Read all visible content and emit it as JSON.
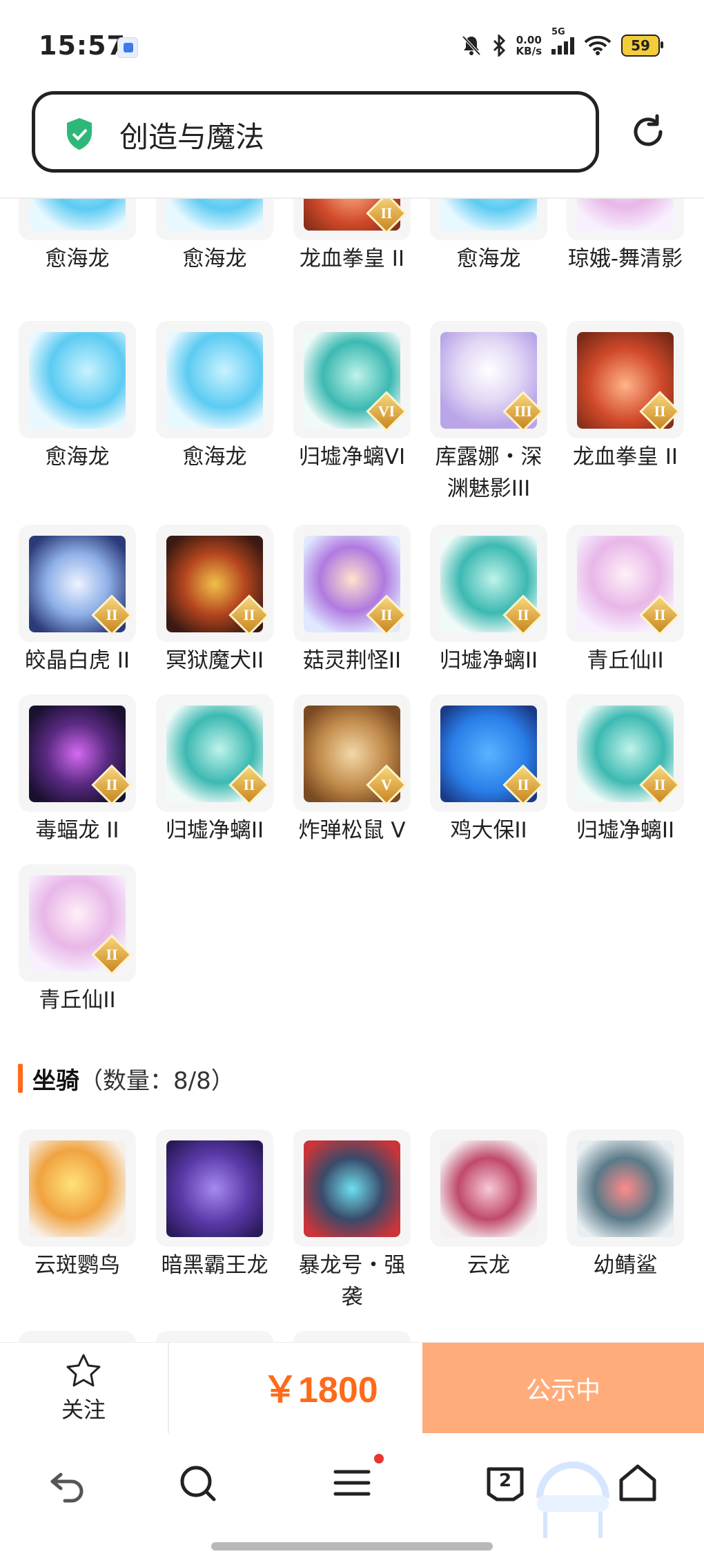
{
  "status_bar": {
    "time": "15:57",
    "net_speed_value": "0.00",
    "net_speed_unit": "KB/s",
    "signal_label": "5G",
    "battery": "59"
  },
  "search": {
    "query": "创造与魔法"
  },
  "pets_partial_row": [
    {
      "name": "愈海龙",
      "art": "a-blue"
    },
    {
      "name": "愈海龙",
      "art": "a-blue"
    },
    {
      "name": "龙血拳皇 II",
      "art": "a-red",
      "badge": "II"
    },
    {
      "name": "愈海龙",
      "art": "a-blue"
    },
    {
      "name": "琼娥-舞清影",
      "art": "a-pink"
    }
  ],
  "pets": [
    {
      "name": "愈海龙",
      "art": "a-blue"
    },
    {
      "name": "愈海龙",
      "art": "a-blue"
    },
    {
      "name": "归墟净螭VI",
      "art": "a-teal",
      "badge": "VI"
    },
    {
      "name": "库露娜・深渊魅影III",
      "art": "a-purple-girl",
      "badge": "III"
    },
    {
      "name": "龙血拳皇 II",
      "art": "a-red",
      "badge": "II"
    },
    {
      "name": "皎晶白虎 II",
      "art": "a-tiger",
      "badge": "II"
    },
    {
      "name": "冥狱魔犬II",
      "art": "a-dog",
      "badge": "II"
    },
    {
      "name": "菇灵荆怪II",
      "art": "a-chibi",
      "badge": "II"
    },
    {
      "name": "归墟净螭II",
      "art": "a-teal",
      "badge": "II"
    },
    {
      "name": "青丘仙II",
      "art": "a-pink",
      "badge": "II"
    },
    {
      "name": "毒蝠龙 II",
      "art": "a-bat",
      "badge": "II"
    },
    {
      "name": "归墟净螭II",
      "art": "a-teal",
      "badge": "II"
    },
    {
      "name": "炸弹松鼠 V",
      "art": "a-squirrel",
      "badge": "V"
    },
    {
      "name": "鸡大保II",
      "art": "a-chick",
      "badge": "II"
    },
    {
      "name": "归墟净螭II",
      "art": "a-teal",
      "badge": "II"
    },
    {
      "name": "青丘仙II",
      "art": "a-pink",
      "badge": "II"
    }
  ],
  "mounts_section": {
    "title": "坐骑",
    "count_label": "（数量：8/8）"
  },
  "mounts": [
    {
      "name": "云斑鹦鸟",
      "art": "a-parrot"
    },
    {
      "name": "暗黑霸王龙",
      "art": "a-trex"
    },
    {
      "name": "暴龙号・强袭",
      "art": "a-mech"
    },
    {
      "name": "云龙",
      "art": "a-cloud"
    },
    {
      "name": "幼鲭鲨",
      "art": "a-shark"
    }
  ],
  "action_bar": {
    "follow_label": "关注",
    "price": "￥1800",
    "status_label": "公示中"
  },
  "nav": {
    "tabs_count": "2"
  },
  "colors": {
    "accent": "#ff6a1a",
    "status_button": "#ffac7a",
    "badge_gold": "#e0a93a",
    "shield_green": "#2db87a"
  },
  "icons": [
    "back-icon",
    "search-icon",
    "menu-icon",
    "tabs-icon",
    "home-icon",
    "star-icon",
    "refresh-icon",
    "shield-icon"
  ]
}
